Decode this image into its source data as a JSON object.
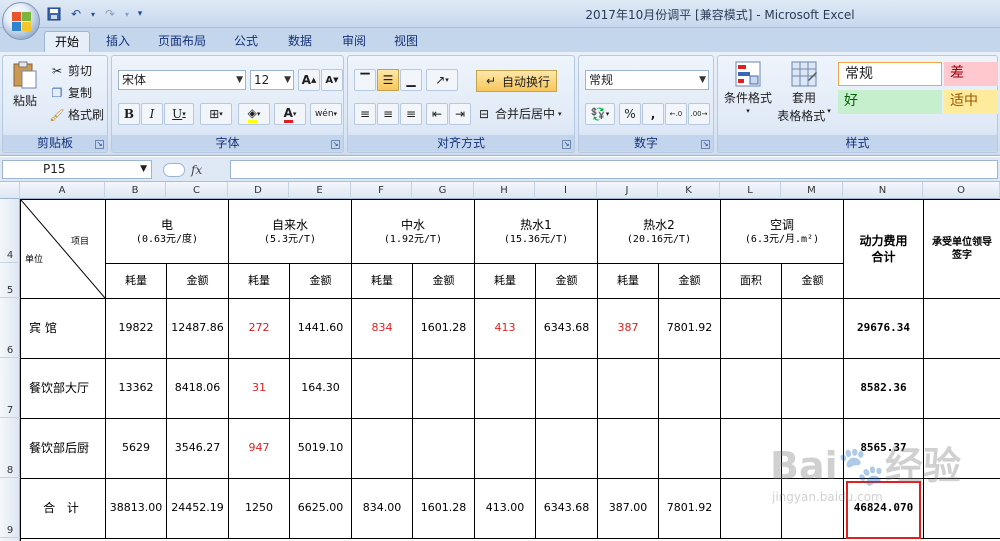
{
  "window": {
    "title": "2017年10月份调平  [兼容模式] - Microsoft Excel"
  },
  "tabs": [
    "开始",
    "插入",
    "页面布局",
    "公式",
    "数据",
    "审阅",
    "视图"
  ],
  "ribbon": {
    "clipboard": {
      "label": "剪贴板",
      "paste": "粘贴",
      "cut": "剪切",
      "copy": "复制",
      "format_painter": "格式刷"
    },
    "font": {
      "label": "字体",
      "font_name": "宋体",
      "font_size": "12",
      "bold": "B",
      "italic": "I",
      "underline": "U",
      "grow": "A",
      "shrink": "A",
      "font_color": "A",
      "phonetic": "wén"
    },
    "alignment": {
      "label": "对齐方式",
      "wrap_text": "自动换行",
      "merge_center": "合并后居中"
    },
    "number": {
      "label": "数字",
      "format": "常规",
      "percent": "%",
      "comma": ",",
      "inc_decimal": "←.0",
      "dec_decimal": ".00→"
    },
    "styles": {
      "label": "样式",
      "conditional_format": "条件格式",
      "table_format_1": "套用",
      "table_format_2": "表格格式",
      "normal": "常规",
      "bad": "差",
      "good": "好",
      "neutral": "适中"
    }
  },
  "formula_bar": {
    "name_box": "P15",
    "fx": "fx",
    "formula": ""
  },
  "columns": [
    "A",
    "B",
    "C",
    "D",
    "E",
    "F",
    "G",
    "H",
    "I",
    "J",
    "K",
    "L",
    "M",
    "N",
    "O"
  ],
  "rows": [
    "4",
    "5",
    "6",
    "7",
    "8",
    "9"
  ],
  "table": {
    "corner": {
      "top": "项目",
      "bottom": "单位"
    },
    "groups": [
      {
        "name": "电",
        "unit": "(0.63元/度)"
      },
      {
        "name": "自来水",
        "unit": "(5.3元/T)"
      },
      {
        "name": "中水",
        "unit": "(1.92元/T)"
      },
      {
        "name": "热水1",
        "unit": "(15.36元/T)"
      },
      {
        "name": "热水2",
        "unit": "(20.16元/T)"
      },
      {
        "name": "空调",
        "unit": "(6.3元/月.m²)"
      }
    ],
    "total_header": "动力费用合计",
    "sign_header": "承受单位领导签字",
    "sub_headers": [
      "耗量",
      "金额",
      "耗量",
      "金额",
      "耗量",
      "金额",
      "耗量",
      "金额",
      "耗量",
      "金额",
      "面积",
      "金额"
    ],
    "data_rows": [
      {
        "unit": "宾 馆",
        "values": [
          "19822",
          "12487.86",
          "272",
          "1441.60",
          "834",
          "1601.28",
          "413",
          "6343.68",
          "387",
          "7801.92",
          "",
          ""
        ],
        "total": "29676.34"
      },
      {
        "unit": "餐饮部大厅",
        "values": [
          "13362",
          "8418.06",
          "31",
          "164.30",
          "",
          "",
          "",
          "",
          "",
          "",
          "",
          ""
        ],
        "total": "8582.36"
      },
      {
        "unit": "餐饮部后厨",
        "values": [
          "5629",
          "3546.27",
          "947",
          "5019.10",
          "",
          "",
          "",
          "",
          "",
          "",
          "",
          ""
        ],
        "total": "8565.37"
      },
      {
        "unit": "合  计",
        "values": [
          "38813.00",
          "24452.19",
          "1250",
          "6625.00",
          "834.00",
          "1601.28",
          "413.00",
          "6343.68",
          "387.00",
          "7801.92",
          "",
          ""
        ],
        "total": "46824.070"
      }
    ]
  },
  "watermark": {
    "brand": "Bai",
    "brand2": "经验",
    "url": "jingyan.baidu.com"
  },
  "colors": {
    "red_value": "#e02020",
    "highlight": "#e02020",
    "style_bad_bg": "#ffc7ce",
    "style_good_bg": "#c6efce",
    "style_neutral_bg": "#ffeb9c"
  }
}
